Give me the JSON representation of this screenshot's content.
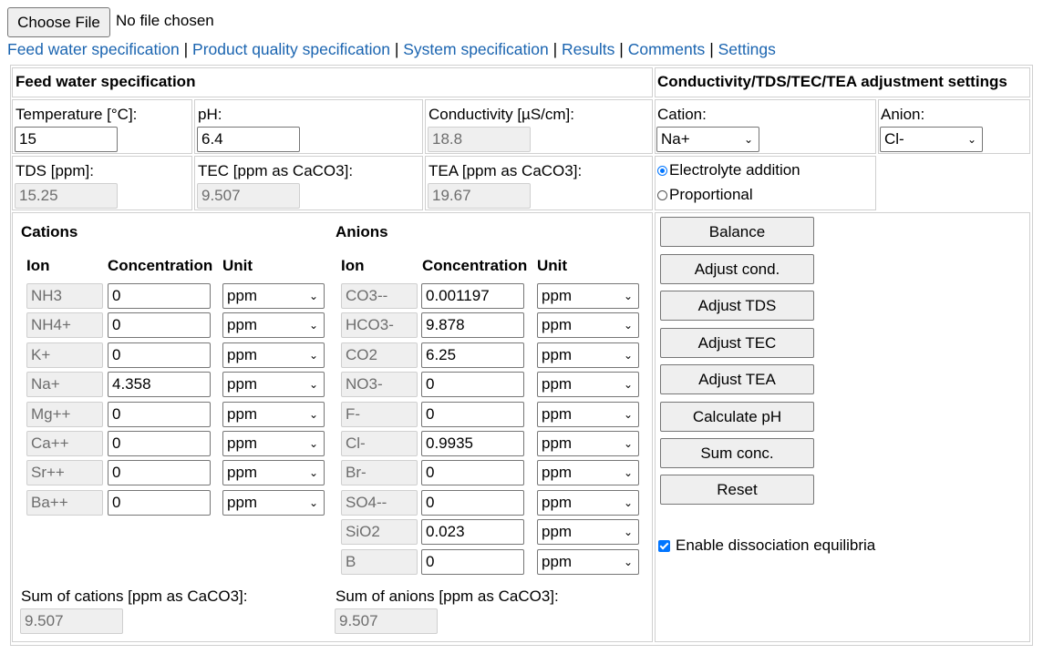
{
  "file": {
    "button": "Choose File",
    "status": "No file chosen"
  },
  "nav": [
    "Feed water specification",
    "Product quality specification",
    "System specification",
    "Results",
    "Comments",
    "Settings"
  ],
  "nav_sep": "|",
  "feed": {
    "title": "Feed water specification",
    "temperature": {
      "label": "Temperature [°C]:",
      "value": "15"
    },
    "ph": {
      "label": "pH:",
      "value": "6.4"
    },
    "conductivity": {
      "label": "Conductivity [µS/cm]:",
      "value": "18.8"
    },
    "tds": {
      "label": "TDS [ppm]:",
      "value": "15.25"
    },
    "tec": {
      "label": "TEC [ppm as CaCO3]:",
      "value": "9.507"
    },
    "tea": {
      "label": "TEA [ppm as CaCO3]:",
      "value": "19.67"
    }
  },
  "adjust": {
    "title": "Conductivity/TDS/TEC/TEA adjustment settings",
    "cation_label": "Cation:",
    "cation_value": "Na+",
    "anion_label": "Anion:",
    "anion_value": "Cl-",
    "radio_electrolyte": "Electrolyte addition",
    "radio_proportional": "Proportional"
  },
  "cations": {
    "title": "Cations",
    "col_ion": "Ion",
    "col_conc": "Concentration",
    "col_unit": "Unit",
    "rows": [
      {
        "ion": "NH3",
        "conc": "0",
        "unit": "ppm"
      },
      {
        "ion": "NH4+",
        "conc": "0",
        "unit": "ppm"
      },
      {
        "ion": "K+",
        "conc": "0",
        "unit": "ppm"
      },
      {
        "ion": "Na+",
        "conc": "4.358",
        "unit": "ppm"
      },
      {
        "ion": "Mg++",
        "conc": "0",
        "unit": "ppm"
      },
      {
        "ion": "Ca++",
        "conc": "0",
        "unit": "ppm"
      },
      {
        "ion": "Sr++",
        "conc": "0",
        "unit": "ppm"
      },
      {
        "ion": "Ba++",
        "conc": "0",
        "unit": "ppm"
      }
    ],
    "sum_label": "Sum of cations [ppm as CaCO3]:",
    "sum_value": "9.507"
  },
  "anions": {
    "title": "Anions",
    "col_ion": "Ion",
    "col_conc": "Concentration",
    "col_unit": "Unit",
    "rows": [
      {
        "ion": "CO3--",
        "conc": "0.001197",
        "unit": "ppm"
      },
      {
        "ion": "HCO3-",
        "conc": "9.878",
        "unit": "ppm"
      },
      {
        "ion": "CO2",
        "conc": "6.25",
        "unit": "ppm"
      },
      {
        "ion": "NO3-",
        "conc": "0",
        "unit": "ppm"
      },
      {
        "ion": "F-",
        "conc": "0",
        "unit": "ppm"
      },
      {
        "ion": "Cl-",
        "conc": "0.9935",
        "unit": "ppm"
      },
      {
        "ion": "Br-",
        "conc": "0",
        "unit": "ppm"
      },
      {
        "ion": "SO4--",
        "conc": "0",
        "unit": "ppm"
      },
      {
        "ion": "SiO2",
        "conc": "0.023",
        "unit": "ppm"
      },
      {
        "ion": "B",
        "conc": "0",
        "unit": "ppm"
      }
    ],
    "sum_label": "Sum of anions [ppm as CaCO3]:",
    "sum_value": "9.507"
  },
  "actions": [
    "Balance",
    "Adjust cond.",
    "Adjust TDS",
    "Adjust TEC",
    "Adjust TEA",
    "Calculate pH",
    "Sum conc.",
    "Reset"
  ],
  "dissociation_label": "Enable dissociation equilibria",
  "chevron": "⌄"
}
